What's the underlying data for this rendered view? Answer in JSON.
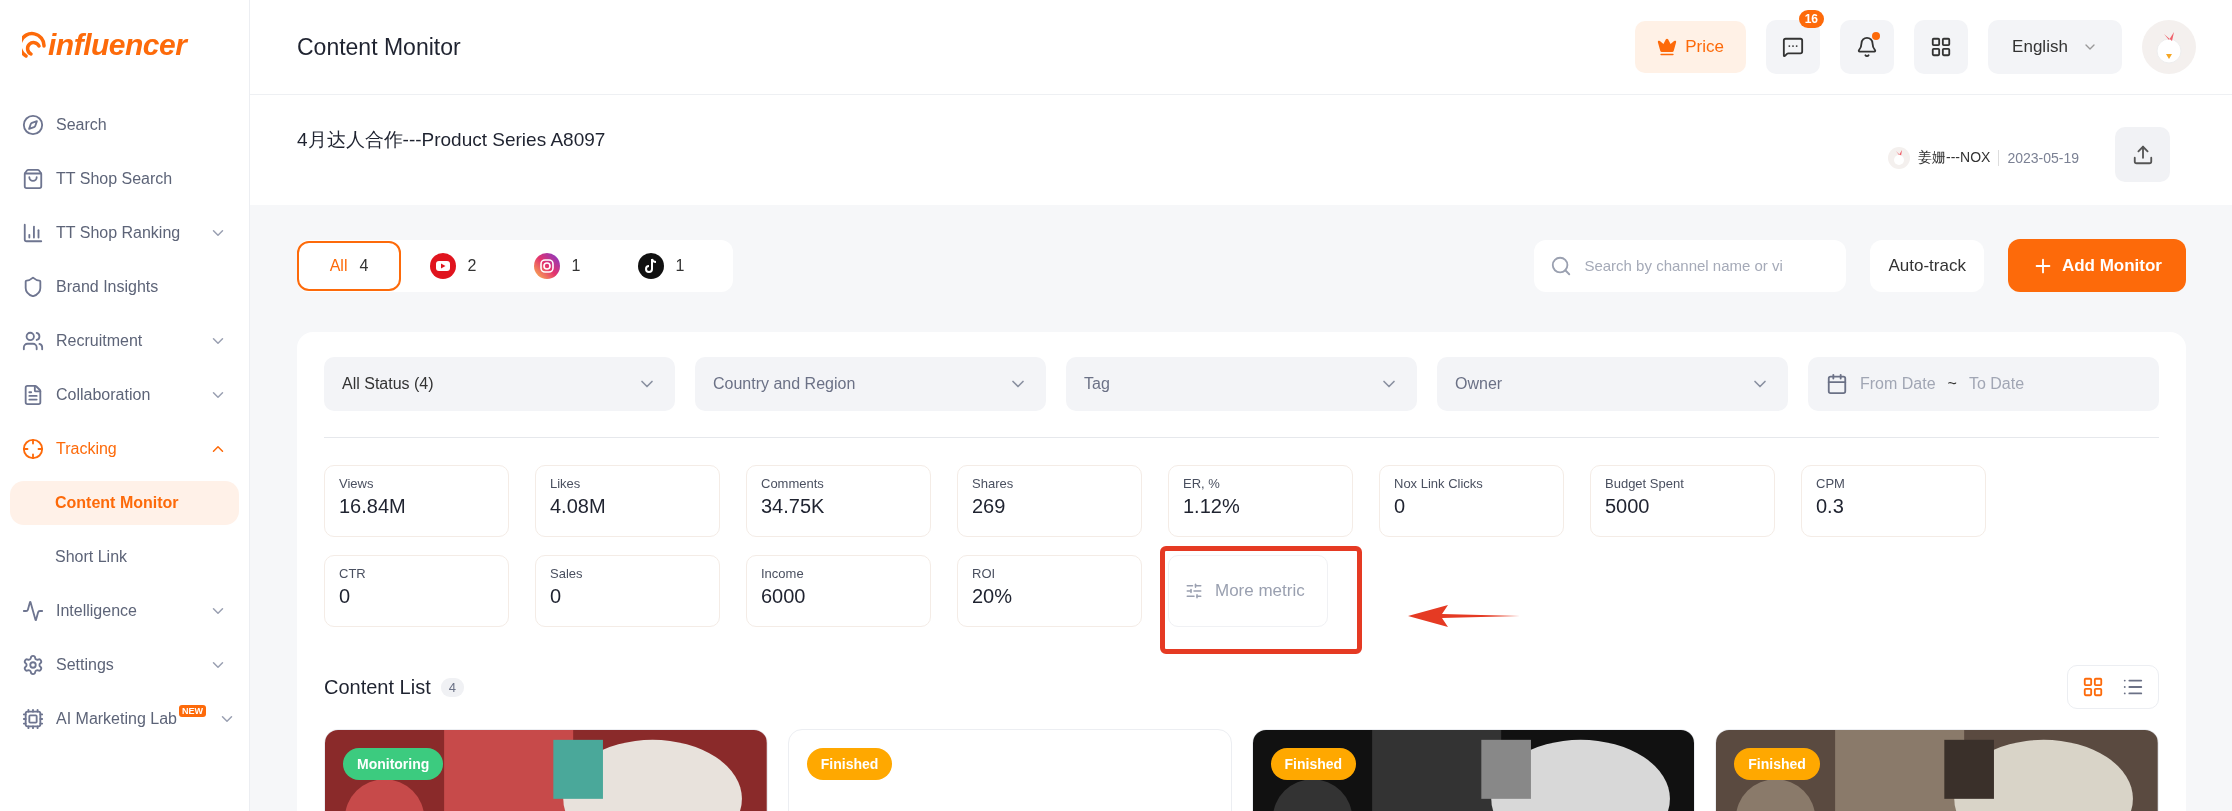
{
  "logo": "influencer",
  "sidebar": {
    "items": [
      {
        "label": "Search",
        "selected": false
      },
      {
        "label": "TT Shop Search",
        "selected": false
      },
      {
        "label": "TT Shop Ranking",
        "expanded": false,
        "selected": false
      },
      {
        "label": "Brand Insights",
        "selected": false
      },
      {
        "label": "Recruitment",
        "expanded": false,
        "selected": false
      },
      {
        "label": "Collaboration",
        "expanded": false,
        "selected": false
      },
      {
        "label": "Tracking",
        "expanded": true,
        "selected": true,
        "children": [
          {
            "label": "Content Monitor",
            "selected": true
          },
          {
            "label": "Short Link",
            "selected": false
          }
        ]
      },
      {
        "label": "Intelligence",
        "expanded": false,
        "selected": false
      },
      {
        "label": "Settings",
        "expanded": false,
        "selected": false
      },
      {
        "label": "AI Marketing Lab",
        "badge": "NEW",
        "expanded": false,
        "selected": false
      }
    ]
  },
  "header": {
    "title": "Content Monitor",
    "price_button": "Price",
    "message_count": "16",
    "notification_dot": true,
    "language": "English"
  },
  "project": {
    "title": "4月达人合作---Product Series A8097",
    "owner": "姜姗---NOX",
    "date": "2023-05-19"
  },
  "platform_tabs": [
    {
      "label": "All",
      "count": "4",
      "selected": true
    },
    {
      "count": "2",
      "selected": false
    },
    {
      "count": "1",
      "selected": false
    },
    {
      "count": "1",
      "selected": false
    }
  ],
  "search": {
    "placeholder": "Search by channel name or vi"
  },
  "auto_track_button": "Auto-track",
  "add_button": "Add Monitor",
  "filters": [
    {
      "kind": "select",
      "value": "All Status (4)"
    },
    {
      "kind": "select",
      "placeholder": "Country and Region"
    },
    {
      "kind": "select",
      "placeholder": "Tag"
    },
    {
      "kind": "select",
      "placeholder": "Owner"
    },
    {
      "kind": "date",
      "from": "From Date",
      "separator": "~",
      "to": "To Date"
    }
  ],
  "metrics": [
    {
      "label": "Views",
      "value": "16.84M"
    },
    {
      "label": "Likes",
      "value": "4.08M"
    },
    {
      "label": "Comments",
      "value": "34.75K"
    },
    {
      "label": "Shares",
      "value": "269"
    },
    {
      "label": "ER, %",
      "value": "1.12%"
    },
    {
      "label": "Nox Link Clicks",
      "value": "0"
    },
    {
      "label": "Budget Spent",
      "value": "5000"
    },
    {
      "label": "CPM",
      "value": "0.3"
    },
    {
      "label": "CTR",
      "value": "0"
    },
    {
      "label": "Sales",
      "value": "0"
    },
    {
      "label": "Income",
      "value": "6000"
    },
    {
      "label": "ROI",
      "value": "20%"
    }
  ],
  "more_metric_button": "More metric",
  "content_list": {
    "title": "Content List",
    "count": "4",
    "view_buttons": [
      {
        "selected": true
      },
      {
        "selected": false
      }
    ],
    "cards": [
      {
        "status": "Monitoring",
        "color": "#3ccb7f",
        "kind": "picture"
      },
      {
        "status": "Finished",
        "color": "#ffa800",
        "kind": "blank"
      },
      {
        "status": "Finished",
        "color": "#ffa800",
        "kind": "picture"
      },
      {
        "status": "Finished",
        "color": "#ffa800",
        "kind": "picture"
      }
    ]
  }
}
